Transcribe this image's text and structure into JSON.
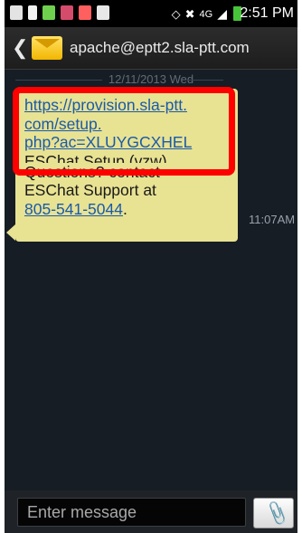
{
  "status_bar": {
    "time": "2:51 PM",
    "network_label": "4G",
    "icons": [
      "message-icon",
      "usb-icon",
      "android-icon",
      "app-icon",
      "missed-call-icon",
      "email-icon",
      "nfc-icon",
      "mute-icon",
      "lte-icon",
      "signal-icon",
      "battery-icon"
    ],
    "colors": {
      "message-icon": "#e3e3e3",
      "usb-icon": "#f2f2f2",
      "android-icon": "#6fd04e",
      "app-icon": "#d54b6b",
      "missed-call-icon": "#ff5f5f",
      "email-icon": "#e8e8e8"
    }
  },
  "header": {
    "back_icon": "chevron-left-icon",
    "contact_icon": "envelope-icon",
    "title": "apache@eptt2.sla-ptt.com"
  },
  "conversation": {
    "date": "12/11/2013 Wed",
    "message": {
      "link_line_1": "https://provision.sla-ptt.",
      "link_line_2": "com/setup.",
      "link_line_3": "php?ac=XLUYGCXHEL",
      "partial_line": "ESChat Setup (vzw)",
      "body_line_1": "Questions? contact",
      "body_line_2": "ESChat Support at",
      "phone": "805-541-5044",
      "phone_suffix": ".",
      "time": "11:07AM"
    }
  },
  "compose": {
    "placeholder": "Enter message",
    "attach_icon": "paperclip-icon"
  },
  "annotation": {
    "highlight_color": "#ff0000"
  }
}
